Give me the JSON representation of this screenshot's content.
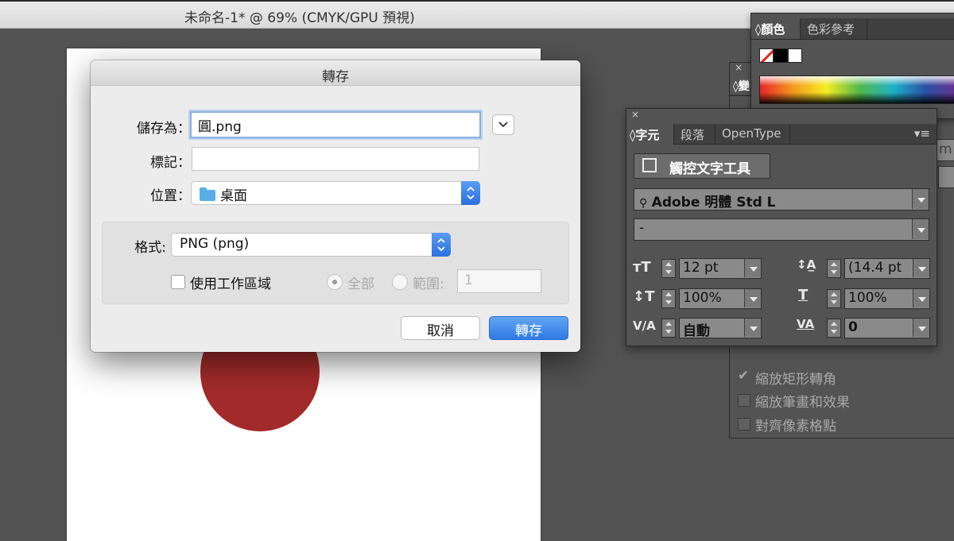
{
  "window": {
    "title": "未命名-1* @ 69% (CMYK/GPU 預視)"
  },
  "dialog": {
    "title": "轉存",
    "save_as_label": "儲存為：",
    "save_as_value": "圓.png",
    "tags_label": "標記：",
    "tags_value": "",
    "location_label": "位置：",
    "location_value": "桌面",
    "format_label": "格式:",
    "format_value": "PNG (png)",
    "use_artboards_label": "使用工作區域",
    "all_label": "全部",
    "range_label": "範圍:",
    "range_value": "1",
    "cancel_label": "取消",
    "export_label": "轉存"
  },
  "color_panel": {
    "tabs": [
      "顏色",
      "色彩參考"
    ],
    "close": "×"
  },
  "back_panel": {
    "close": "×",
    "tab_fragment": "變",
    "input_fragment": "m"
  },
  "character_panel": {
    "close": "×",
    "tabs": [
      "字元",
      "段落",
      "OpenType"
    ],
    "touch_type_label": "觸控文字工具",
    "font_family": "Adobe 明體 Std L",
    "font_style": "-",
    "font_size": "12 pt",
    "leading": "(14.4 pt",
    "vertical_scale": "100%",
    "horizontal_scale": "100%",
    "kerning": "自動",
    "tracking": "0"
  },
  "transform_options": {
    "scale_corners": "縮放矩形轉角",
    "scale_strokes": "縮放筆畫和效果",
    "align_pixel_grid": "對齊像素格點"
  },
  "colors": {
    "accent": "#2f7ae3",
    "artwork_circle": "#a32a2a"
  }
}
